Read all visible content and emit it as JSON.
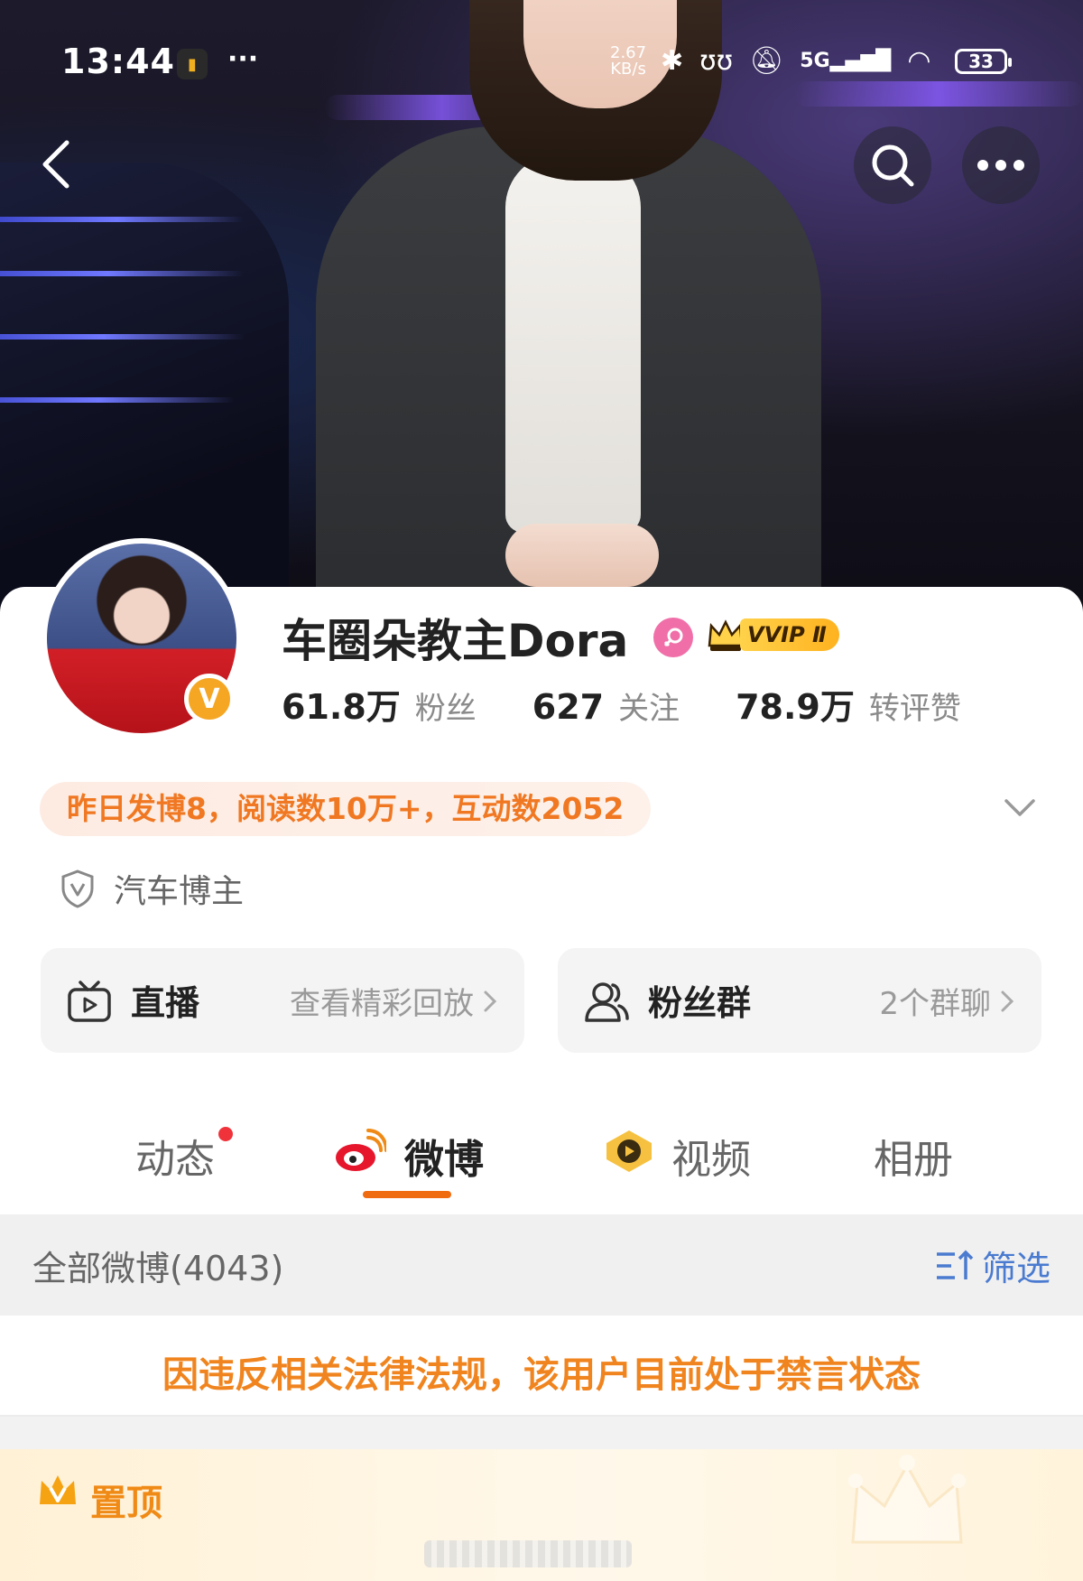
{
  "status_bar": {
    "time": "13:44",
    "speed_value": "2.67",
    "speed_unit": "KB/s",
    "network": "5G",
    "battery": "33"
  },
  "profile": {
    "name": "车圈朵教主Dora",
    "vip_label": "VVIP Ⅱ",
    "stats": [
      {
        "num": "61.8万",
        "label": "粉丝"
      },
      {
        "num": "627",
        "label": "关注"
      },
      {
        "num": "78.9万",
        "label": "转评赞"
      }
    ],
    "summary": "昨日发博8，阅读数10万+，互动数2052",
    "tag": "汽车博主"
  },
  "actions": {
    "live": {
      "title": "直播",
      "right": "查看精彩回放"
    },
    "fans": {
      "title": "粉丝群",
      "right": "2个群聊"
    }
  },
  "tabs": [
    {
      "label": "动态"
    },
    {
      "label": "微博"
    },
    {
      "label": "视频"
    },
    {
      "label": "相册"
    }
  ],
  "feed": {
    "section_title": "全部微博(4043)",
    "filter_label": "筛选",
    "notice": "因违反相关法律法规，该用户目前处于禁言状态",
    "pinned_label": "置顶"
  },
  "colors": {
    "accent": "#f06a0f",
    "notice": "#f0841e",
    "filter_blue": "#4a7bd0",
    "vip_gold": "#ffc83a"
  },
  "icons": [
    "back-icon",
    "search-icon",
    "more-icon",
    "verified-v-icon",
    "female-icon",
    "crown-icon",
    "shield-v-icon",
    "tv-icon",
    "group-icon",
    "weibo-icon",
    "video-icon",
    "filter-icon",
    "chevron-down-icon",
    "chevron-right-icon"
  ]
}
